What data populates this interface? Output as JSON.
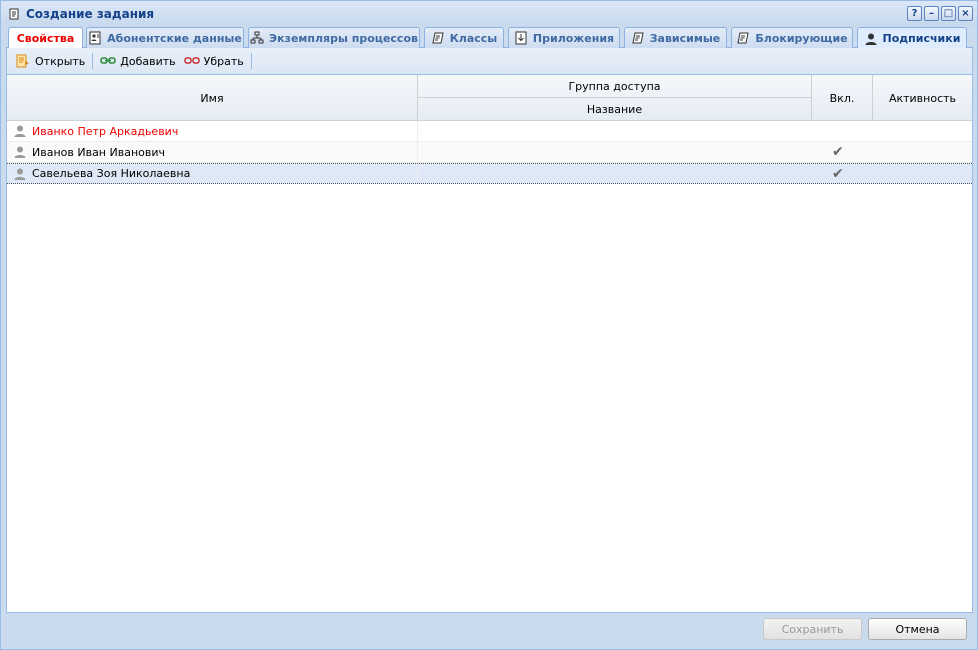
{
  "window": {
    "title": "Создание задания",
    "tools": [
      "?",
      "–",
      "□",
      "×"
    ]
  },
  "tabs": [
    {
      "label": "Свойства",
      "icon": "none",
      "state": "red"
    },
    {
      "label": "Абонентские данные",
      "icon": "contact-card-icon"
    },
    {
      "label": "Экземпляры процессов",
      "icon": "process-tree-icon"
    },
    {
      "label": "Классы",
      "icon": "scroll-icon"
    },
    {
      "label": "Приложения",
      "icon": "attachment-down-icon"
    },
    {
      "label": "Зависимые",
      "icon": "scroll-icon"
    },
    {
      "label": "Блокирующие",
      "icon": "scroll-icon"
    },
    {
      "label": "Подписчики",
      "icon": "user-icon",
      "state": "active"
    }
  ],
  "toolbar": {
    "open_label": "Открыть",
    "add_label": "Добавить",
    "remove_label": "Убрать"
  },
  "grid": {
    "col_name": "Имя",
    "group_header": "Группа доступа",
    "col_group_name": "Название",
    "col_enabled": "Вкл.",
    "col_activity": "Активность",
    "rows": [
      {
        "name": "Иванко Петр Аркадьевич",
        "group": "",
        "enabled": false,
        "activity": "",
        "highlight": "red"
      },
      {
        "name": "Иванов Иван Иванович",
        "group": "",
        "enabled": true,
        "activity": ""
      },
      {
        "name": "Савельева Зоя Николаевна",
        "group": "",
        "enabled": true,
        "activity": "",
        "selected": true
      }
    ],
    "check_glyph": "✔"
  },
  "footer": {
    "save_label": "Сохранить",
    "cancel_label": "Отмена"
  }
}
